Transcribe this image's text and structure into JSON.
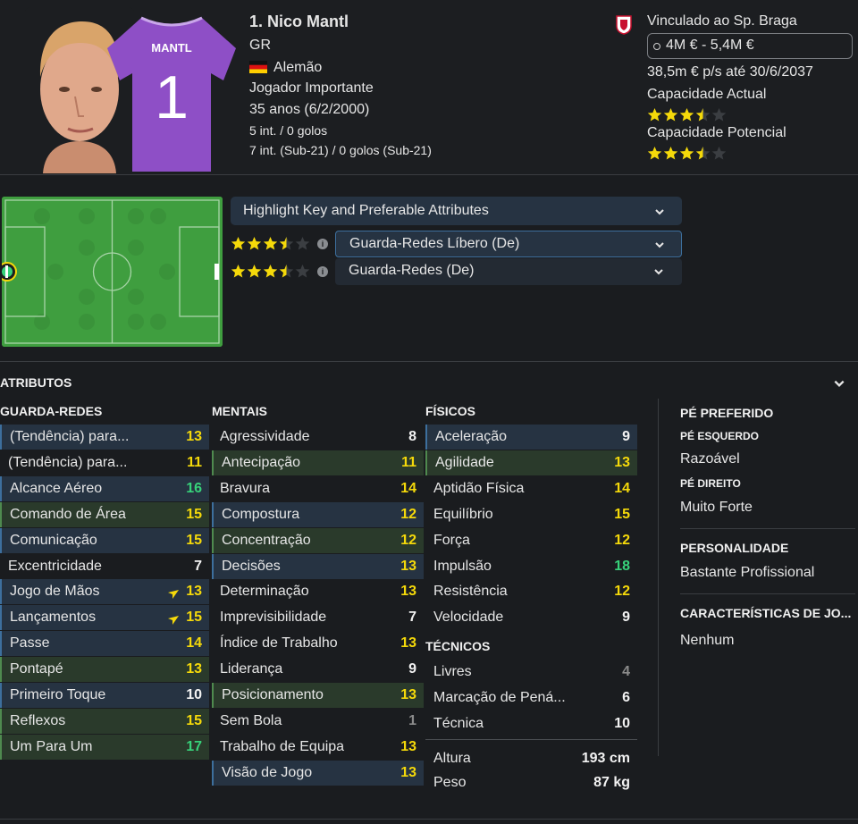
{
  "player": {
    "name": "1. Nico Mantl",
    "position": "GR",
    "nationality": "Alemão",
    "status": "Jogador Importante",
    "age": "35 anos (6/2/2000)",
    "caps": "5 int. / 0 golos",
    "caps_u21": "7 int. (Sub-21) / 0 golos (Sub-21)",
    "shirt_name": "MANTL",
    "shirt_number": "1"
  },
  "contract": {
    "club": "Vinculado ao Sp. Braga",
    "value": "4M € - 5,4M €",
    "wage": "38,5m € p/s até 30/6/2037",
    "ca_label": "Capacidade Actual",
    "ca_stars": 3.5,
    "pa_label": "Capacidade Potencial",
    "pa_stars": 3.5
  },
  "roles": {
    "highlight_label": "Highlight Key and Preferable Attributes",
    "items": [
      {
        "name": "Guarda-Redes Líbero (De)",
        "stars": 3.5
      },
      {
        "name": "Guarda-Redes (De)",
        "stars": 3.5
      }
    ]
  },
  "attributes_title": "ATRIBUTOS",
  "goalkeeping": {
    "title": "GUARDA-REDES",
    "rows": [
      {
        "label": "(Tendência) para...",
        "value": "13",
        "hl": "blue",
        "color": "yellow"
      },
      {
        "label": "(Tendência) para...",
        "value": "11",
        "hl": "",
        "color": "yellow"
      },
      {
        "label": "Alcance Aéreo",
        "value": "16",
        "hl": "blue",
        "color": "green"
      },
      {
        "label": "Comando de Área",
        "value": "15",
        "hl": "green",
        "color": "yellow"
      },
      {
        "label": "Comunicação",
        "value": "15",
        "hl": "blue",
        "color": "yellow"
      },
      {
        "label": "Excentricidade",
        "value": "7",
        "hl": "",
        "color": "white"
      },
      {
        "label": "Jogo de Mãos",
        "value": "13",
        "hl": "blue",
        "color": "yellow",
        "flag": true
      },
      {
        "label": "Lançamentos",
        "value": "15",
        "hl": "blue",
        "color": "yellow",
        "flag": true
      },
      {
        "label": "Passe",
        "value": "14",
        "hl": "blue",
        "color": "yellow"
      },
      {
        "label": "Pontapé",
        "value": "13",
        "hl": "green",
        "color": "yellow"
      },
      {
        "label": "Primeiro Toque",
        "value": "10",
        "hl": "blue",
        "color": "white"
      },
      {
        "label": "Reflexos",
        "value": "15",
        "hl": "green",
        "color": "yellow"
      },
      {
        "label": "Um Para Um",
        "value": "17",
        "hl": "green",
        "color": "green"
      }
    ]
  },
  "mental": {
    "title": "MENTAIS",
    "rows": [
      {
        "label": "Agressividade",
        "value": "8",
        "hl": "",
        "color": "white"
      },
      {
        "label": "Antecipação",
        "value": "11",
        "hl": "green",
        "color": "yellow"
      },
      {
        "label": "Bravura",
        "value": "14",
        "hl": "",
        "color": "yellow"
      },
      {
        "label": "Compostura",
        "value": "12",
        "hl": "blue",
        "color": "yellow"
      },
      {
        "label": "Concentração",
        "value": "12",
        "hl": "green",
        "color": "yellow"
      },
      {
        "label": "Decisões",
        "value": "13",
        "hl": "blue",
        "color": "yellow"
      },
      {
        "label": "Determinação",
        "value": "13",
        "hl": "",
        "color": "yellow"
      },
      {
        "label": "Imprevisibilidade",
        "value": "7",
        "hl": "",
        "color": "white"
      },
      {
        "label": "Índice de Trabalho",
        "value": "13",
        "hl": "",
        "color": "yellow"
      },
      {
        "label": "Liderança",
        "value": "9",
        "hl": "",
        "color": "white"
      },
      {
        "label": "Posicionamento",
        "value": "13",
        "hl": "green",
        "color": "yellow"
      },
      {
        "label": "Sem Bola",
        "value": "1",
        "hl": "",
        "color": "gray"
      },
      {
        "label": "Trabalho de Equipa",
        "value": "13",
        "hl": "",
        "color": "yellow"
      },
      {
        "label": "Visão de Jogo",
        "value": "13",
        "hl": "blue",
        "color": "yellow"
      }
    ]
  },
  "physical": {
    "title": "FÍSICOS",
    "rows": [
      {
        "label": "Aceleração",
        "value": "9",
        "hl": "blue",
        "color": "white"
      },
      {
        "label": "Agilidade",
        "value": "13",
        "hl": "green",
        "color": "yellow"
      },
      {
        "label": "Aptidão Física",
        "value": "14",
        "hl": "",
        "color": "yellow"
      },
      {
        "label": "Equilíbrio",
        "value": "15",
        "hl": "",
        "color": "yellow"
      },
      {
        "label": "Força",
        "value": "12",
        "hl": "",
        "color": "yellow"
      },
      {
        "label": "Impulsão",
        "value": "18",
        "hl": "",
        "color": "green"
      },
      {
        "label": "Resistência",
        "value": "12",
        "hl": "",
        "color": "yellow"
      },
      {
        "label": "Velocidade",
        "value": "9",
        "hl": "",
        "color": "white"
      }
    ]
  },
  "technical": {
    "title": "TÉCNICOS",
    "rows": [
      {
        "label": "Livres",
        "value": "4",
        "hl": "",
        "color": "gray"
      },
      {
        "label": "Marcação de Pená...",
        "value": "6",
        "hl": "",
        "color": "white"
      },
      {
        "label": "Técnica",
        "value": "10",
        "hl": "",
        "color": "white"
      }
    ]
  },
  "body": {
    "height_label": "Altura",
    "height": "193 cm",
    "weight_label": "Peso",
    "weight": "87 kg"
  },
  "right_panel": {
    "foot_title": "PÉ PREFERIDO",
    "left_foot_label": "PÉ ESQUERDO",
    "left_foot": "Razoável",
    "right_foot_label": "PÉ DIREITO",
    "right_foot": "Muito Forte",
    "personality_title": "PERSONALIDADE",
    "personality": "Bastante Profissional",
    "traits_title": "CARACTERÍSTICAS DE JO...",
    "traits": "Nenhum"
  },
  "colors": {
    "pitch": "#3f9e3f",
    "yellow": "#f5d90a",
    "green": "#37d27a",
    "highlight_blue": "#263342",
    "highlight_green": "#2a3a2b",
    "shirt": "#8e4fc6"
  }
}
